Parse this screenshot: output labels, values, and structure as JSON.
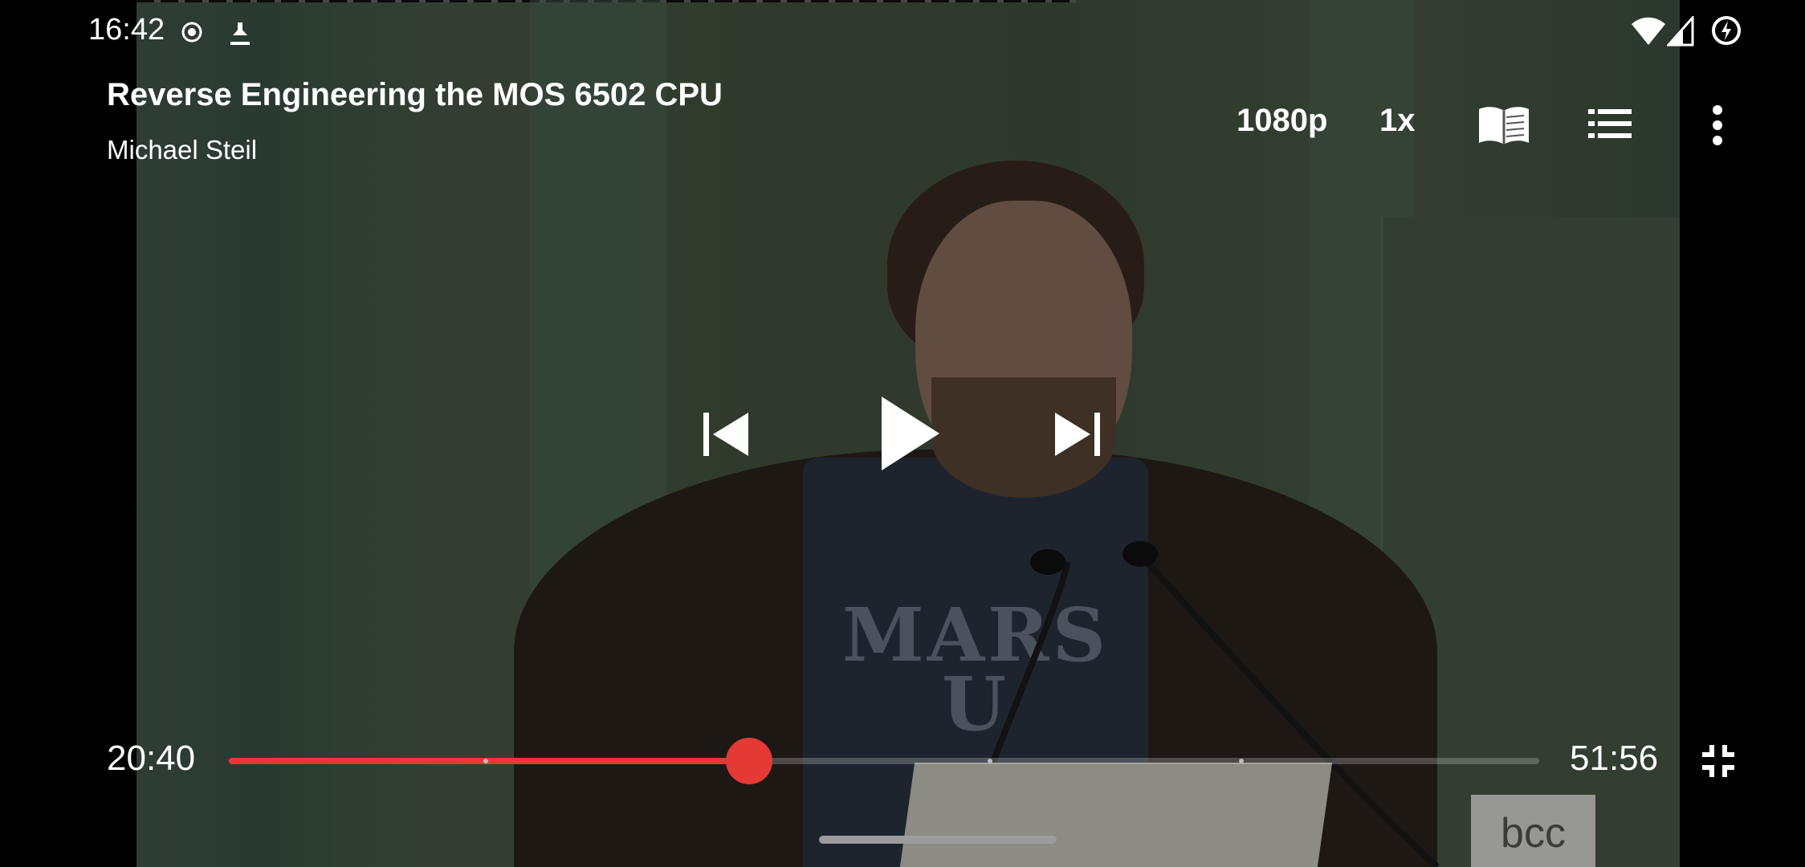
{
  "status_bar": {
    "time": "16:42",
    "left_icons": [
      "record-icon",
      "download-icon"
    ],
    "right_icons": [
      "wifi-icon",
      "cell-signal-icon",
      "battery-saver-icon"
    ]
  },
  "video": {
    "title": "Reverse Engineering the MOS 6502 CPU",
    "speaker": "Michael Steil",
    "shirt_text": "MARS U",
    "logo_text": "bcc"
  },
  "top_controls": {
    "quality": "1080p",
    "speed": "1x",
    "icons": [
      "book-icon",
      "list-icon",
      "more-vert-icon"
    ]
  },
  "playback": {
    "elapsed": "20:40",
    "duration": "51:56",
    "progress": 0.397,
    "chapters": [
      0.194,
      0.579,
      0.771
    ],
    "state": "paused"
  },
  "colors": {
    "accent": "#e53935",
    "text": "#ffffff"
  }
}
